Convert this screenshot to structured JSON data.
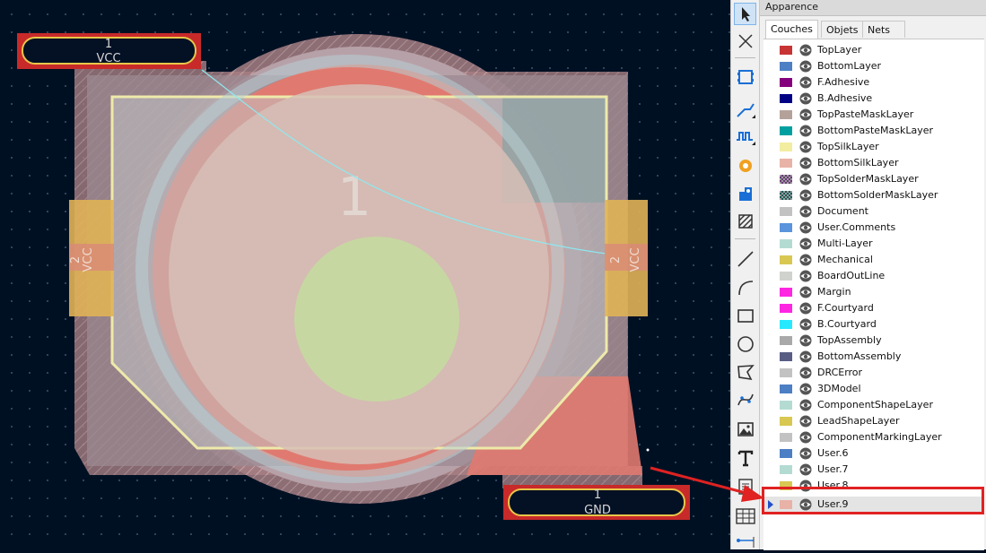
{
  "panel": {
    "title": "Apparence",
    "tabs": [
      {
        "label": "Couches",
        "active": true
      },
      {
        "label": "Objets",
        "active": false
      },
      {
        "label": "Nets",
        "active": false
      }
    ],
    "layers": [
      {
        "name": "TopLayer",
        "color": "#c83434"
      },
      {
        "name": "BottomLayer",
        "color": "#4d7fc4"
      },
      {
        "name": "F.Adhesive",
        "color": "#84007c"
      },
      {
        "name": "B.Adhesive",
        "color": "#000084"
      },
      {
        "name": "TopPasteMaskLayer",
        "color": "#b4a29a"
      },
      {
        "name": "BottomPasteMaskLayer",
        "color": "#00a0a0"
      },
      {
        "name": "TopSilkLayer",
        "color": "#f2eda1"
      },
      {
        "name": "BottomSilkLayer",
        "color": "#e8b2a7"
      },
      {
        "name": "TopSolderMaskLayer",
        "color": "#6c3a7a",
        "pattern": true
      },
      {
        "name": "BottomSolderMaskLayer",
        "color": "#1a5c5a",
        "pattern": true
      },
      {
        "name": "Document",
        "color": "#c2c2c2"
      },
      {
        "name": "User.Comments",
        "color": "#5994dc"
      },
      {
        "name": "Multi-Layer",
        "color": "#b4dbd2"
      },
      {
        "name": "Mechanical",
        "color": "#d8c852"
      },
      {
        "name": "BoardOutLine",
        "color": "#d0d2cd"
      },
      {
        "name": "Margin",
        "color": "#ff26e2"
      },
      {
        "name": "F.Courtyard",
        "color": "#ff26e2"
      },
      {
        "name": "B.Courtyard",
        "color": "#26e9ff"
      },
      {
        "name": "TopAssembly",
        "color": "#a9a9a9"
      },
      {
        "name": "BottomAssembly",
        "color": "#585d84"
      },
      {
        "name": "DRCError",
        "color": "#c2c2c2"
      },
      {
        "name": "3DModel",
        "color": "#4d7fc4"
      },
      {
        "name": "ComponentShapeLayer",
        "color": "#b4dbd2"
      },
      {
        "name": "LeadShapeLayer",
        "color": "#d8c852"
      },
      {
        "name": "ComponentMarkingLayer",
        "color": "#c2c2c2"
      },
      {
        "name": "User.6",
        "color": "#4d7fc4"
      },
      {
        "name": "User.7",
        "color": "#b4dbd2"
      },
      {
        "name": "User.8",
        "color": "#d8c852"
      },
      {
        "name": "User.9",
        "color": "#e8b2a7",
        "selected": true
      }
    ]
  },
  "canvas": {
    "pad_top_left": {
      "number": "1",
      "net": "VCC"
    },
    "pad_bottom_right": {
      "number": "1",
      "net": "GND"
    },
    "pad_left": {
      "number": "2",
      "net": "VCC"
    },
    "pad_right": {
      "number": "2",
      "net": "VCC"
    },
    "silk_number": "1"
  },
  "toolbar": {
    "tools": [
      "select-icon",
      "route-off-icon",
      "footprint-icon",
      "route-track-icon",
      "tune-length-icon",
      "via-icon",
      "pad-icon",
      "zone-icon",
      "line-icon",
      "arc-icon",
      "rectangle-icon",
      "circle-icon",
      "polygon-icon",
      "bezier-icon",
      "image-icon",
      "text-icon",
      "textbox-icon",
      "table-icon",
      "dimension-icon"
    ]
  }
}
